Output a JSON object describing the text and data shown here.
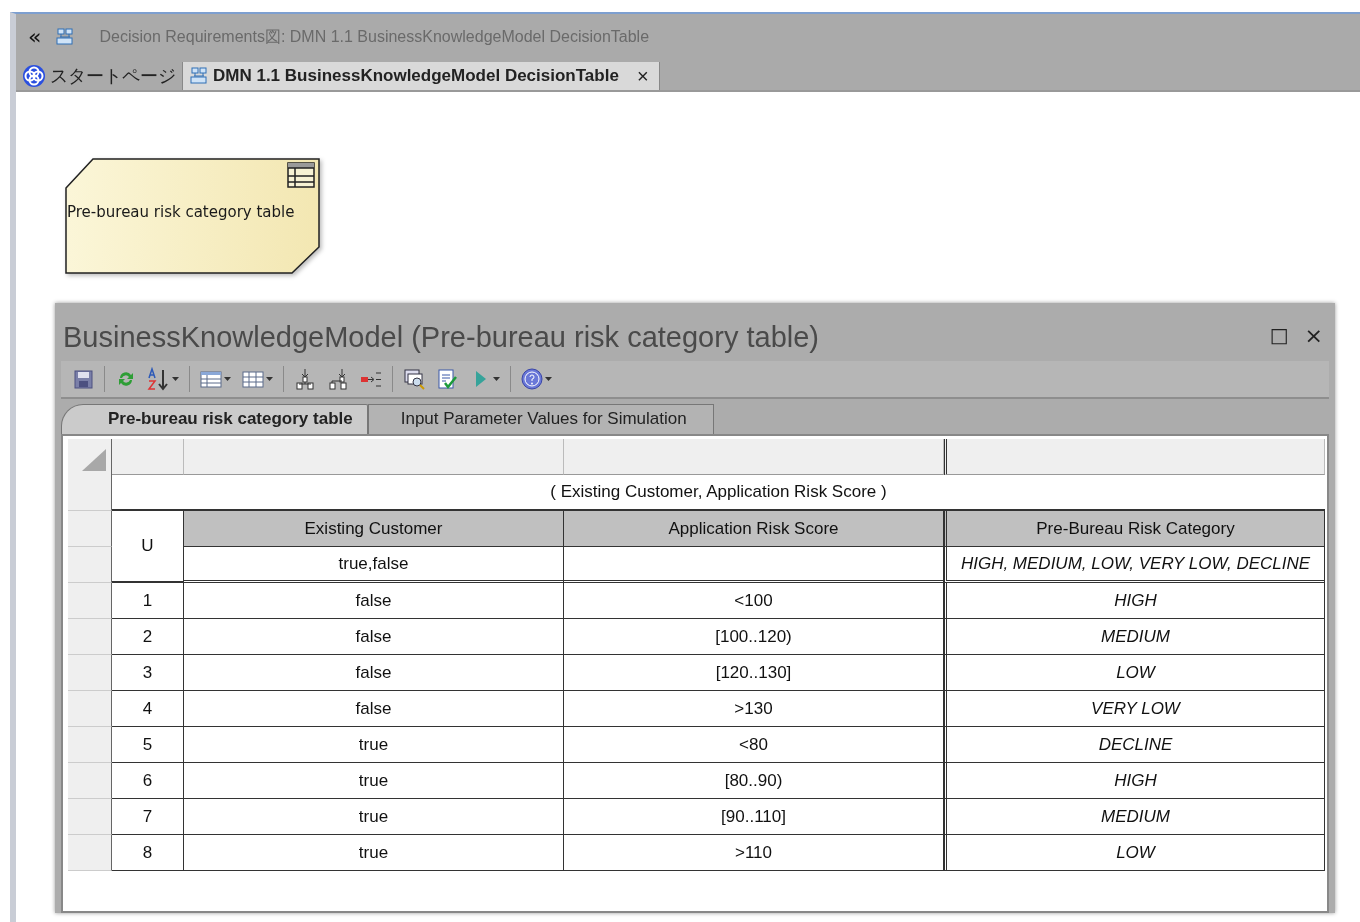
{
  "breadcrumb": {
    "back": "«",
    "text": "Decision Requirements図: DMN 1.1 BusinessKnowledgeModel DecisionTable"
  },
  "tabs": [
    {
      "label": "スタートページ",
      "selected": false,
      "kind": "start"
    },
    {
      "label": "DMN 1.1 BusinessKnowledgeModel DecisionTable",
      "selected": true,
      "kind": "diagram",
      "close": "×"
    }
  ],
  "diagram_element": {
    "label": "Pre-bureau risk category table"
  },
  "panel": {
    "title": "BusinessKnowledgeModel (Pre-bureau risk category table)",
    "maximize": "□",
    "close": "×",
    "tabs": [
      {
        "label": "Pre-bureau risk category table",
        "selected": true
      },
      {
        "label": "Input Parameter Values for Simulation",
        "selected": false
      }
    ],
    "table": {
      "hit_policy": "U",
      "expression": "( Existing Customer, Application Risk Score )",
      "inputs": [
        {
          "name": "Existing Customer",
          "values": "true,false"
        },
        {
          "name": "Application Risk Score"
        }
      ],
      "outputs": [
        {
          "name": "Pre-Bureau Risk Category",
          "values": "HIGH, MEDIUM, LOW, VERY LOW, DECLINE"
        }
      ],
      "rules": [
        {
          "number": "1",
          "inputs": [
            "false",
            "<100"
          ],
          "outputs": [
            "HIGH"
          ]
        },
        {
          "number": "2",
          "inputs": [
            "false",
            "[100..120)"
          ],
          "outputs": [
            "MEDIUM"
          ]
        },
        {
          "number": "3",
          "inputs": [
            "false",
            "[120..130]"
          ],
          "outputs": [
            "LOW"
          ]
        },
        {
          "number": "4",
          "inputs": [
            "false",
            ">130"
          ],
          "outputs": [
            "VERY LOW"
          ]
        },
        {
          "number": "5",
          "inputs": [
            "true",
            "<80"
          ],
          "outputs": [
            "DECLINE"
          ]
        },
        {
          "number": "6",
          "inputs": [
            "true",
            "[80..90)"
          ],
          "outputs": [
            "HIGH"
          ]
        },
        {
          "number": "7",
          "inputs": [
            "true",
            "[90..110]"
          ],
          "outputs": [
            "MEDIUM"
          ]
        },
        {
          "number": "8",
          "inputs": [
            "true",
            ">110"
          ],
          "outputs": [
            "LOW"
          ]
        }
      ]
    }
  }
}
